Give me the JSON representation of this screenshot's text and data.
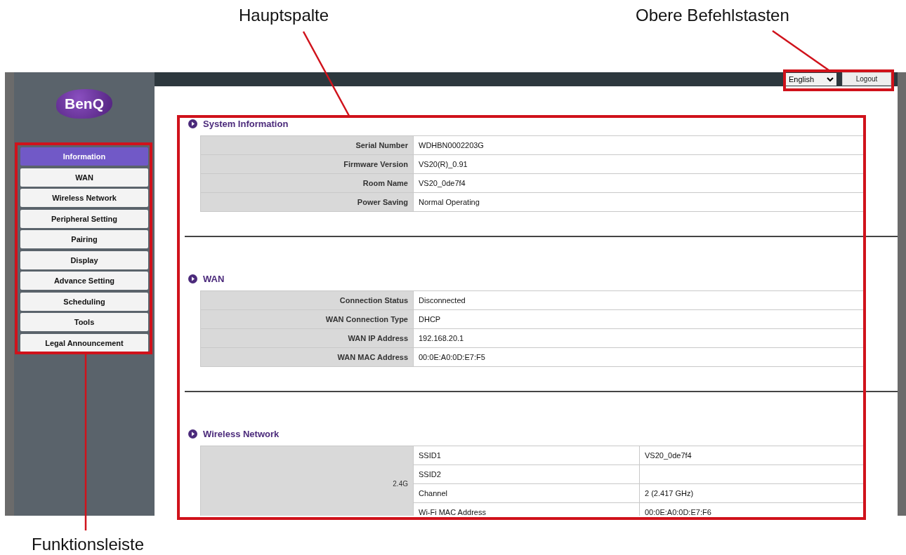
{
  "annotations": [
    {
      "label": "Hauptspalte",
      "kind": "main"
    },
    {
      "label": "Obere Befehlstasten",
      "kind": "top"
    },
    {
      "label": "Funktionsleiste",
      "kind": "menu"
    }
  ],
  "sidebar": {
    "logo_text": "BenQ",
    "items": [
      {
        "label": "Information",
        "selected": true
      },
      {
        "label": "WAN",
        "selected": false
      },
      {
        "label": "Wireless Network",
        "selected": false
      },
      {
        "label": "Peripheral Setting",
        "selected": false
      },
      {
        "label": "Pairing",
        "selected": false
      },
      {
        "label": "Display",
        "selected": false
      },
      {
        "label": "Advance Setting",
        "selected": false
      },
      {
        "label": "Scheduling",
        "selected": false
      },
      {
        "label": "Tools",
        "selected": false
      },
      {
        "label": "Legal Announcement",
        "selected": false
      }
    ]
  },
  "top_bar": {
    "language": "English",
    "logout": "Logout"
  },
  "sections": [
    {
      "title": "System Information",
      "rows": [
        {
          "label": "Serial Number",
          "value": "WDHBN0002203G"
        },
        {
          "label": "Firmware Version",
          "value": "VS20(R)_0.91"
        },
        {
          "label": "Room Name",
          "value": "VS20_0de7f4"
        },
        {
          "label": "Power Saving",
          "value": "Normal Operating"
        }
      ]
    },
    {
      "title": "WAN",
      "rows": [
        {
          "label": "Connection Status",
          "value": "Disconnected"
        },
        {
          "label": "WAN Connection Type",
          "value": "DHCP"
        },
        {
          "label": "WAN IP Address",
          "value": "192.168.20.1"
        },
        {
          "label": "WAN MAC Address",
          "value": "00:0E:A0:0D:E7:F5"
        }
      ]
    }
  ],
  "wireless": {
    "title": "Wireless Network",
    "band": "2.4G",
    "rows": [
      {
        "label": "SSID1",
        "value": "VS20_0de7f4"
      },
      {
        "label": "SSID2"
      },
      {
        "label": "Channel",
        "value": "2 (2.417 GHz)"
      },
      {
        "label": "Wi-Fi MAC Address",
        "value": "00:0E:A0:0D:E7:F6"
      }
    ]
  }
}
